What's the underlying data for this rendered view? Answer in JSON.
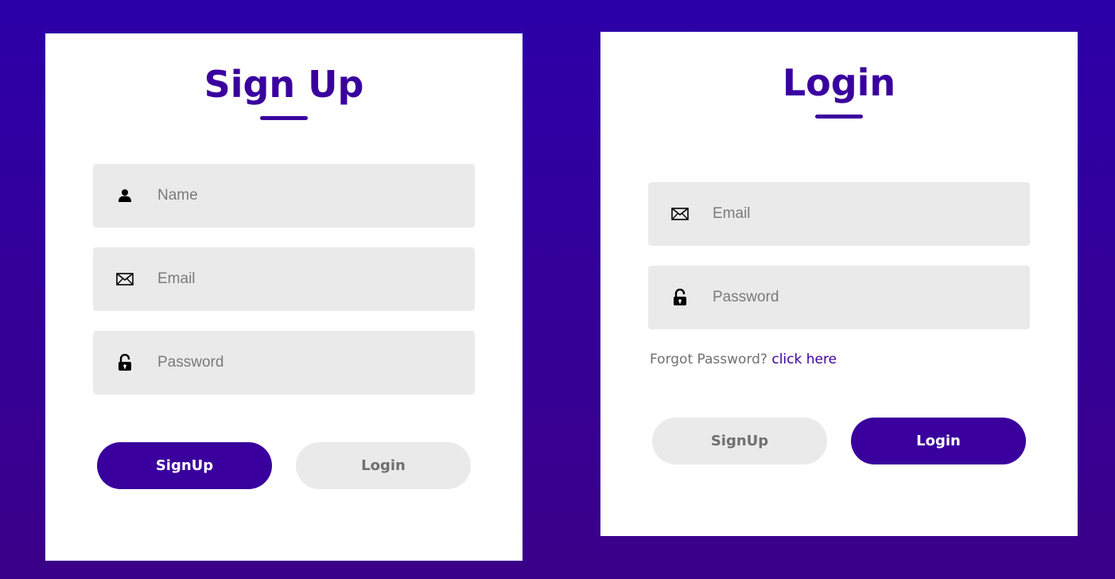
{
  "colors": {
    "background_top": "#2c00a8",
    "background_bottom": "#3b0089",
    "accent": "#3a009e",
    "field_bg": "#eaeaea",
    "card_bg": "#ffffff"
  },
  "signup": {
    "title": "Sign Up",
    "fields": [
      {
        "icon": "user-icon",
        "placeholder": "Name"
      },
      {
        "icon": "envelope-icon",
        "placeholder": "Email"
      },
      {
        "icon": "lock-icon",
        "placeholder": "Password"
      }
    ],
    "buttons": {
      "signup": "SignUp",
      "login": "Login"
    }
  },
  "login": {
    "title": "Login",
    "fields": [
      {
        "icon": "envelope-icon",
        "placeholder": "Email"
      },
      {
        "icon": "lock-icon",
        "placeholder": "Password"
      }
    ],
    "forgot": {
      "text": "Forgot Password?",
      "link": "click here"
    },
    "buttons": {
      "signup": "SignUp",
      "login": "Login"
    }
  }
}
